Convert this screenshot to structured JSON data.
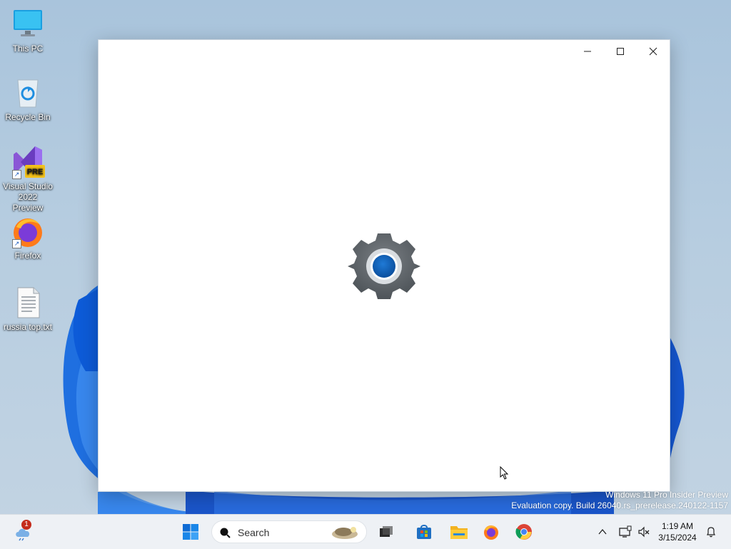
{
  "desktop": {
    "icons": [
      {
        "label": "This PC"
      },
      {
        "label": "Recycle Bin"
      },
      {
        "label": "Visual Studio 2022 Preview",
        "badge": "PRE"
      },
      {
        "label": "Firefox"
      },
      {
        "label": "russia top.txt"
      }
    ]
  },
  "window": {
    "controls": {
      "minimize": "minimize-icon",
      "maximize": "maximize-icon",
      "close": "close-icon"
    },
    "splash_icon": "settings-gear-icon"
  },
  "watermark": {
    "line1": "Windows 11 Pro Insider Preview",
    "line2": "Evaluation copy. Build 26040.rs_prerelease.240122-1157"
  },
  "taskbar": {
    "widgets_badge": "1",
    "search_placeholder": "Search",
    "apps": [
      "start-icon",
      "task-view-icon",
      "store-icon",
      "file-explorer-icon",
      "firefox-icon",
      "chrome-icon"
    ],
    "clock": {
      "time": "1:19 AM",
      "date": "3/15/2024"
    }
  },
  "colors": {
    "accent": "#0067c0",
    "gear": "#5f6468",
    "taskbar": "#eef1f5"
  }
}
